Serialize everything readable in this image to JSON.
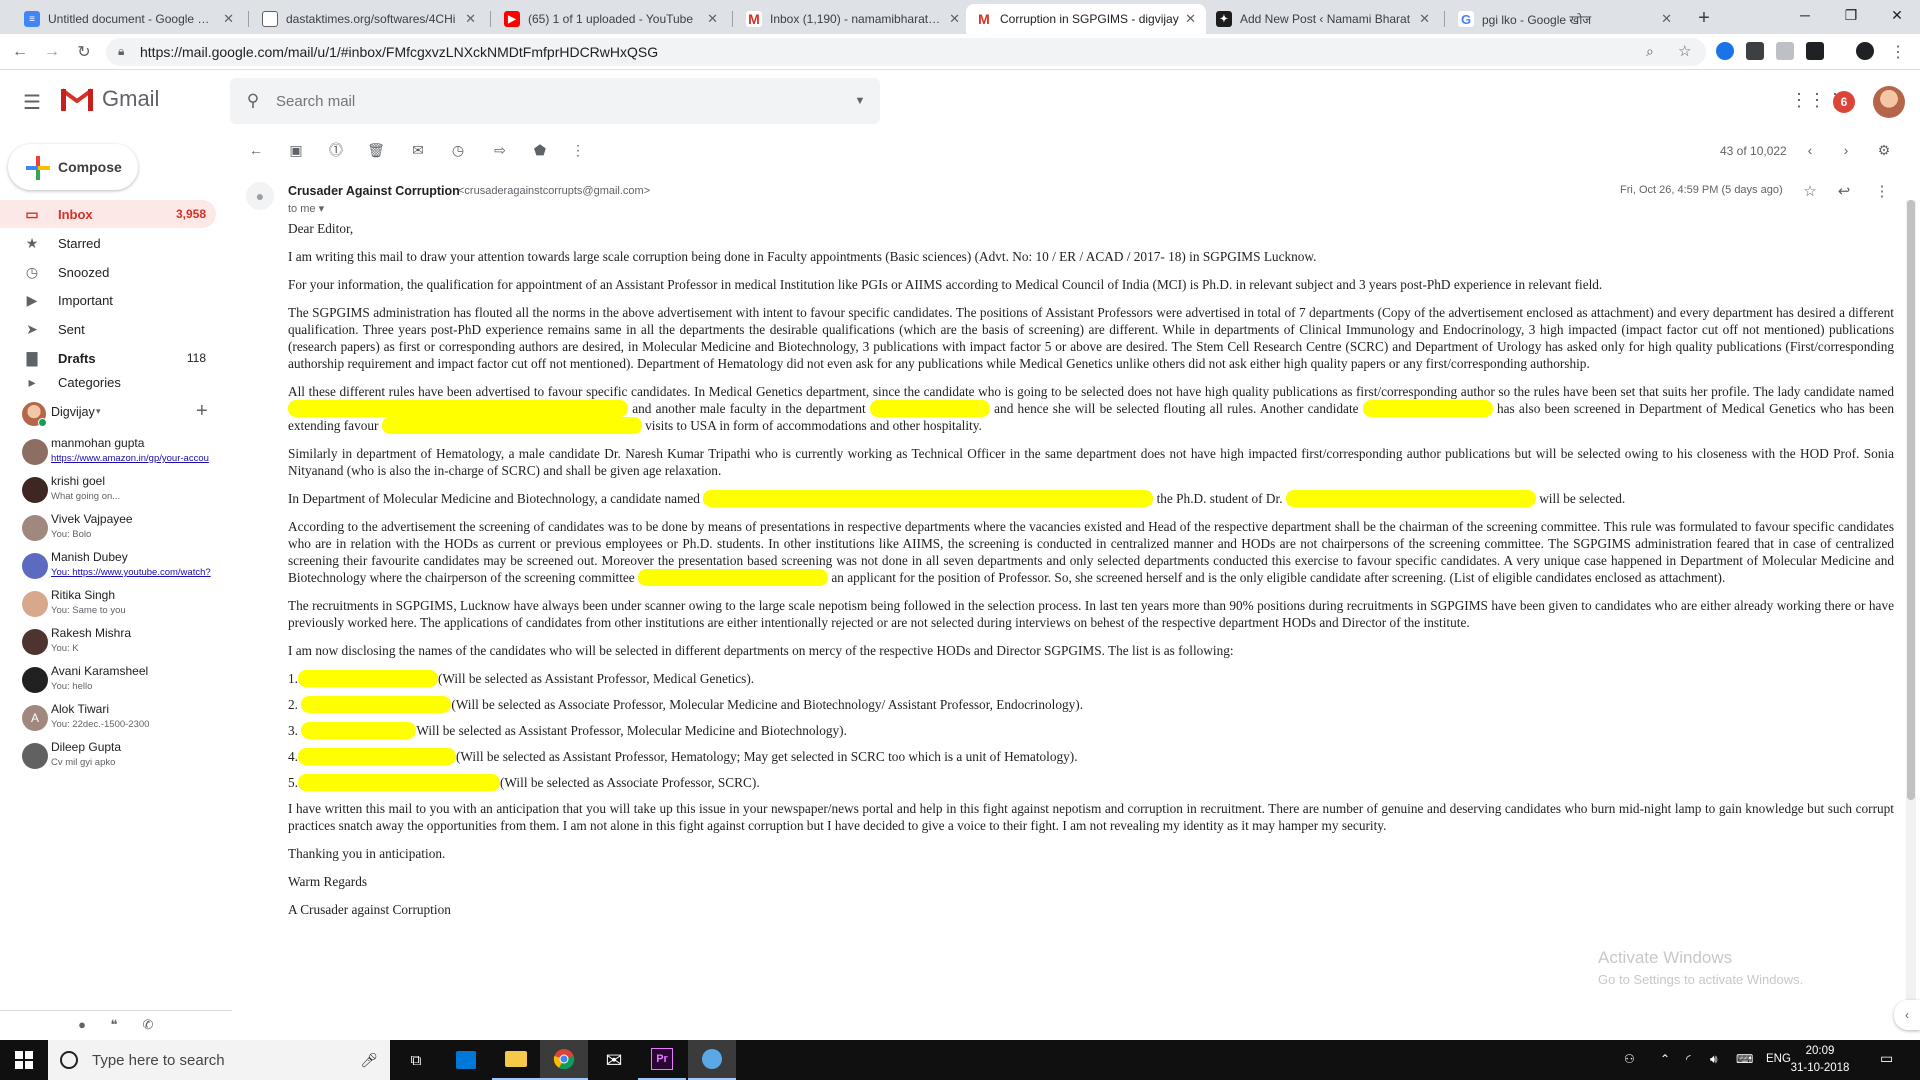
{
  "browser": {
    "tabs": [
      {
        "title": "Untitled document - Google Doc",
        "color": "#4285f4",
        "glyph": "≡"
      },
      {
        "title": "dastaktimes.org/softwares/4CHi",
        "color": "#ffffff",
        "glyph": ""
      },
      {
        "title": "(65) 1 of 1 uploaded - YouTube",
        "color": "#ff0000",
        "glyph": "▶"
      },
      {
        "title": "Inbox (1,190) - namamibharat@g",
        "color": "#ffffff",
        "glyph": "M"
      },
      {
        "title": "Corruption in SGPGIMS - digvijay",
        "color": "#ffffff",
        "glyph": "M"
      },
      {
        "title": "Add New Post ‹ Namami Bharat",
        "color": "#1d1d1d",
        "glyph": "✦"
      },
      {
        "title": "pgi lko - Google खोज",
        "color": "#ffffff",
        "glyph": "G"
      }
    ],
    "url": "https://mail.google.com/mail/u/1/#inbox/FMfcgxvzLNXckNMDtFmfprHDCRwHxQSG"
  },
  "gmail": {
    "product": "Gmail",
    "search_placeholder": "Search mail",
    "notification_count": "6"
  },
  "sidebar": {
    "compose": "Compose",
    "items": [
      {
        "label": "Inbox",
        "count": "3,958",
        "icon": "inbox-icon"
      },
      {
        "label": "Starred",
        "count": "",
        "icon": "star-icon"
      },
      {
        "label": "Snoozed",
        "count": "",
        "icon": "clock-icon"
      },
      {
        "label": "Important",
        "count": "",
        "icon": "important-icon"
      },
      {
        "label": "Sent",
        "count": "",
        "icon": "send-icon"
      },
      {
        "label": "Drafts",
        "count": "118",
        "icon": "draft-icon"
      },
      {
        "label": "Categories",
        "count": "",
        "icon": "label-icon"
      }
    ],
    "hangouts_user": "Digvijay",
    "contacts": [
      {
        "name": "manmohan gupta",
        "status": "https://www.amazon.in/gp/your-accou",
        "link": true,
        "color": "#8d6e63"
      },
      {
        "name": "krishi goel",
        "status": "What going on...",
        "link": false,
        "color": "#3e2723"
      },
      {
        "name": "Vivek Vajpayee",
        "status": "You: Bolo",
        "link": false,
        "color": "#a1887f"
      },
      {
        "name": "Manish Dubey",
        "status": "You: https://www.youtube.com/watch?",
        "link": true,
        "color": "#5c6bc0"
      },
      {
        "name": "Ritika Singh",
        "status": "You: Same to you",
        "link": false,
        "color": "#d7a88c"
      },
      {
        "name": "Rakesh Mishra",
        "status": "You: K",
        "link": false,
        "color": "#4e342e"
      },
      {
        "name": "Avani Karamsheel",
        "status": "You: hello",
        "link": false,
        "color": "#212121"
      },
      {
        "name": "Alok Tiwari",
        "status": "You: 22dec.-1500-2300",
        "link": false,
        "color": "#a1887f",
        "initial": "A"
      },
      {
        "name": "Dileep Gupta",
        "status": "Cv mil gyi apko",
        "link": false,
        "color": "#616161"
      }
    ]
  },
  "toolbar": {
    "pager": "43 of 10,022"
  },
  "message": {
    "sender_name": "Crusader Against Corruption",
    "sender_email": "<crusaderagainstcorrupts@gmail.com>",
    "to": "to me",
    "date": "Fri, Oct 26, 4:59 PM (5 days ago)",
    "greeting": "Dear Editor,",
    "p1": "I am writing this mail to draw your attention towards large scale corruption being done in Faculty appointments (Basic sciences) (Advt. No: 10 / ER / ACAD / 2017- 18) in SGPGIMS Lucknow.",
    "p2": "For your information, the qualification for appointment of an Assistant Professor in medical Institution like PGIs or AIIMS according to Medical Council of India (MCI) is Ph.D. in relevant subject and 3 years post-PhD experience in relevant field.",
    "p3": "The SGPGIMS administration has flouted all the norms in the above advertisement with intent to favour specific candidates. The positions of Assistant Professors were advertised in total of 7 departments (Copy of the advertisement enclosed as attachment) and every department has desired a different qualification. Three years post-PhD experience remains same in all the departments the desirable qualifications (which are the basis of screening) are different. While in departments of Clinical Immunology and Endocrinology, 3 high impacted (impact factor cut off not mentioned) publications (research papers) as first or corresponding authors are desired, in Molecular Medicine and Biotechnology, 3 publications with impact factor 5 or above are desired. The Stem Cell Research Centre (SCRC) and Department of Urology has asked only for high quality publications (First/corresponding authorship requirement and impact factor cut off not mentioned). Department of Hematology did not even ask for any publications while Medical Genetics unlike others did not ask either high quality papers or any first/corresponding authorship.",
    "p4a": "All these different rules have been advertised to favour specific candidates. In Medical Genetics department, since the candidate who is going to be selected does not have high quality publications as first/corresponding author so the rules have been set that suits her profile. The lady candidate named",
    "p4b": "and another male faculty in the department",
    "p4c": "and hence she will be selected flouting all rules. Another candidate",
    "p4d": "has also been screened in Department of Medical Genetics who has been extending favour",
    "p4e": "visits to USA in form of accommodations and other hospitality.",
    "p5": "Similarly in department of Hematology, a male candidate Dr. Naresh Kumar Tripathi who is currently working as Technical Officer in the same department does not have high impacted first/corresponding author publications but will be selected owing to his closeness with the HOD Prof. Sonia Nityanand (who is also the in-charge of SCRC) and shall be given age relaxation.",
    "p6a": "In Department of Molecular Medicine and Biotechnology, a candidate named",
    "p6b": "the Ph.D. student of Dr.",
    "p6c": "will be selected.",
    "p7a": "According to the advertisement the screening of candidates was to be done by means of presentations in respective departments where the vacancies existed and Head of the respective department shall be the chairman of the screening committee. This rule was formulated to favour specific candidates who are in relation with the HODs as current or previous employees or Ph.D. students. In other institutions like AIIMS, the screening is conducted in centralized manner and HODs are not chairpersons of the screening committee. The SGPGIMS administration feared that in case of centralized screening their favourite candidates may be screened out. Moreover the presentation based screening was not done in all seven departments and only selected departments conducted this exercise to favour specific candidates. A very unique case happened in Department of Molecular Medicine and Biotechnology where the chairperson of the screening committee",
    "p7b": "an applicant for the position of Professor. So, she screened herself and is the only eligible candidate after screening. (List of eligible candidates enclosed as attachment).",
    "p8": "The recruitments in SGPGIMS, Lucknow have always been under scanner owing to the large scale nepotism being followed in the selection process. In last ten years more than 90% positions during recruitments in SGPGIMS have been given to candidates who are either already working there or have previously worked here. The applications of candidates from other institutions are either intentionally rejected or are not selected during interviews on behest of the respective department HODs and Director of the institute.",
    "p9": "I am now disclosing the names of the candidates who will be selected in different departments on mercy of the respective HODs and Director SGPGIMS. The list is as following:",
    "list": [
      {
        "num": "1.",
        "text": "(Will be selected as Assistant Professor, Medical Genetics)."
      },
      {
        "num": "2.",
        "text": "(Will be selected as Associate Professor, Molecular Medicine and Biotechnology/ Assistant Professor, Endocrinology)."
      },
      {
        "num": "3.",
        "text": "Will be selected as Assistant Professor, Molecular Medicine and Biotechnology)."
      },
      {
        "num": "4.",
        "text": "(Will be selected as Assistant Professor, Hematology; May get selected in SCRC too which is a unit of Hematology)."
      },
      {
        "num": "5.",
        "text": "(Will be selected as Associate Professor, SCRC)."
      }
    ],
    "p10": "I have written this mail to you with an anticipation that you will take up this issue in your newspaper/news portal and help in this fight against nepotism and corruption in recruitment. There are number of genuine and deserving candidates who burn mid-night lamp to gain knowledge but such corrupt practices snatch away the opportunities from them. I am not alone in this fight against corruption but I have decided to give a voice to their fight. I am not revealing my identity as it may hamper my security.",
    "p11": "Thanking you in anticipation.",
    "p12": "Warm Regards",
    "p13": "A Crusader against Corruption"
  },
  "watermark": {
    "line1": "Activate Windows",
    "line2": "Go to Settings to activate Windows."
  },
  "taskbar": {
    "search_placeholder": "Type here to search",
    "lang": "ENG",
    "time": "20:09",
    "date": "31-10-2018"
  }
}
